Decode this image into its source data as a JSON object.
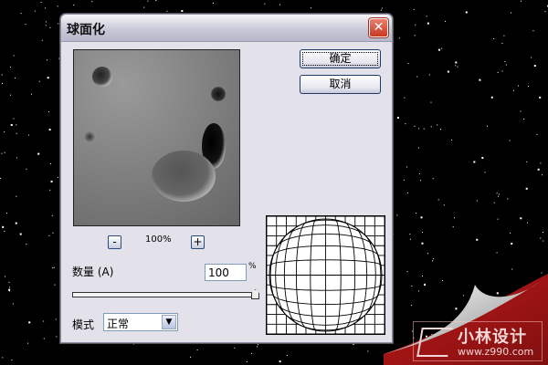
{
  "dialog": {
    "title": "球面化",
    "close_icon": "close-icon",
    "ok_label": "确定",
    "cancel_label": "取消",
    "zoom": {
      "value": "100%",
      "minus": "-",
      "plus": "+"
    },
    "amount": {
      "label": "数量",
      "hotkey": "(A)",
      "value": "100",
      "unit": "%",
      "slider_fraction": 1.0
    },
    "mode": {
      "label": "模式",
      "selected": "正常"
    }
  },
  "watermark": {
    "name": "小林设计",
    "url": "www.z990.com"
  },
  "colors": {
    "accent_red": "#a81010",
    "dialog_bg": "#e3e2ea"
  }
}
